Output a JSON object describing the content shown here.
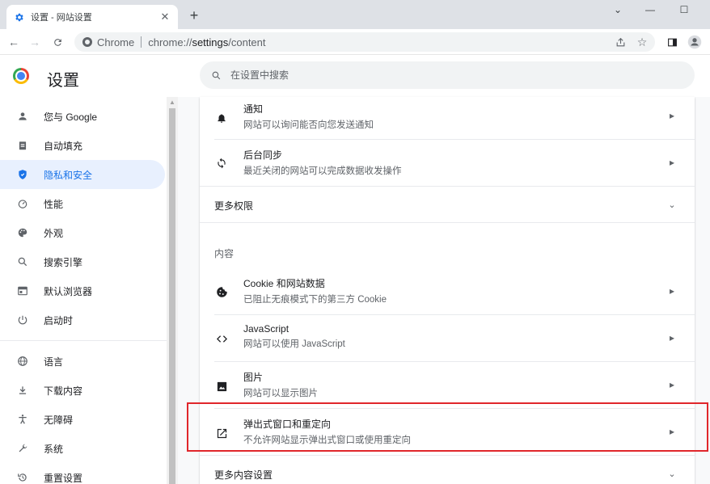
{
  "tab": {
    "title": "设置 - 网站设置",
    "close": "✕",
    "new": "+"
  },
  "window": {
    "minimize": "—",
    "maximize": "☐",
    "chevron": "⌄"
  },
  "toolbar": {
    "chip": "Chrome",
    "url_prefix": "chrome://",
    "url_host": "settings",
    "url_path": "/content"
  },
  "header": {
    "title": "设置",
    "search_placeholder": "在设置中搜索"
  },
  "sidebar": {
    "items": [
      {
        "label": "您与 Google",
        "icon": "person-icon"
      },
      {
        "label": "自动填充",
        "icon": "clipboard-icon"
      },
      {
        "label": "隐私和安全",
        "icon": "shield-icon"
      },
      {
        "label": "性能",
        "icon": "speedometer-icon"
      },
      {
        "label": "外观",
        "icon": "palette-icon"
      },
      {
        "label": "搜索引擎",
        "icon": "search-icon"
      },
      {
        "label": "默认浏览器",
        "icon": "browser-icon"
      },
      {
        "label": "启动时",
        "icon": "power-icon"
      },
      {
        "label": "语言",
        "icon": "globe-icon"
      },
      {
        "label": "下载内容",
        "icon": "download-icon"
      },
      {
        "label": "无障碍",
        "icon": "accessibility-icon"
      },
      {
        "label": "系统",
        "icon": "wrench-icon"
      },
      {
        "label": "重置设置",
        "icon": "restore-icon"
      }
    ],
    "active": "隐私和安全"
  },
  "main": {
    "notifications": {
      "title": "通知",
      "sub": "网站可以询问能否向您发送通知"
    },
    "background_sync": {
      "title": "后台同步",
      "sub": "最近关闭的网站可以完成数据收发操作"
    },
    "more_permissions": "更多权限",
    "content_label": "内容",
    "cookies": {
      "title": "Cookie 和网站数据",
      "sub": "已阻止无痕模式下的第三方 Cookie"
    },
    "javascript": {
      "title": "JavaScript",
      "sub": "网站可以使用 JavaScript"
    },
    "images": {
      "title": "图片",
      "sub": "网站可以显示图片"
    },
    "popups": {
      "title": "弹出式窗口和重定向",
      "sub": "不允许网站显示弹出式窗口或使用重定向"
    },
    "more_content": "更多内容设置"
  },
  "colors": {
    "accent": "#1a73e8",
    "active_bg": "#e8f0fe",
    "highlight": "#e0262b"
  }
}
